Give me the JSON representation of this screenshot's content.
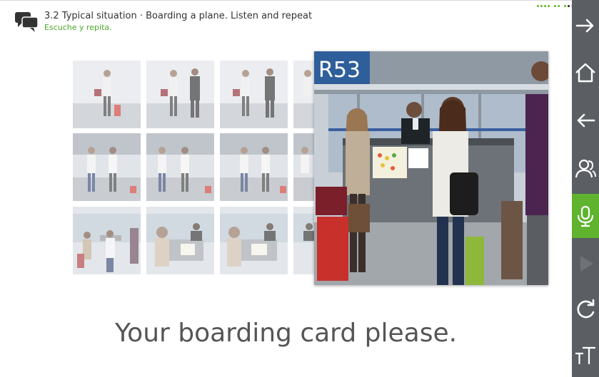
{
  "header": {
    "title": "3.2 Typical situation · Boarding a plane. Listen and repeat",
    "subtitle": "Escuche y repita."
  },
  "caption": "Your boarding card please.",
  "main_photo": {
    "gate_sign": "R53"
  },
  "sidebar": {
    "items": [
      {
        "icon": "arrow-right-icon"
      },
      {
        "icon": "home-icon"
      },
      {
        "icon": "arrow-left-icon"
      },
      {
        "icon": "people-icon"
      },
      {
        "icon": "microphone-icon",
        "active": true
      },
      {
        "icon": "play-icon",
        "disabled": true
      },
      {
        "icon": "repeat-icon"
      },
      {
        "icon": "text-size-icon"
      }
    ]
  },
  "colors": {
    "accent_green": "#5fb32e",
    "sidebar": "#5b5f63",
    "subtitle_green": "#4caa27"
  }
}
